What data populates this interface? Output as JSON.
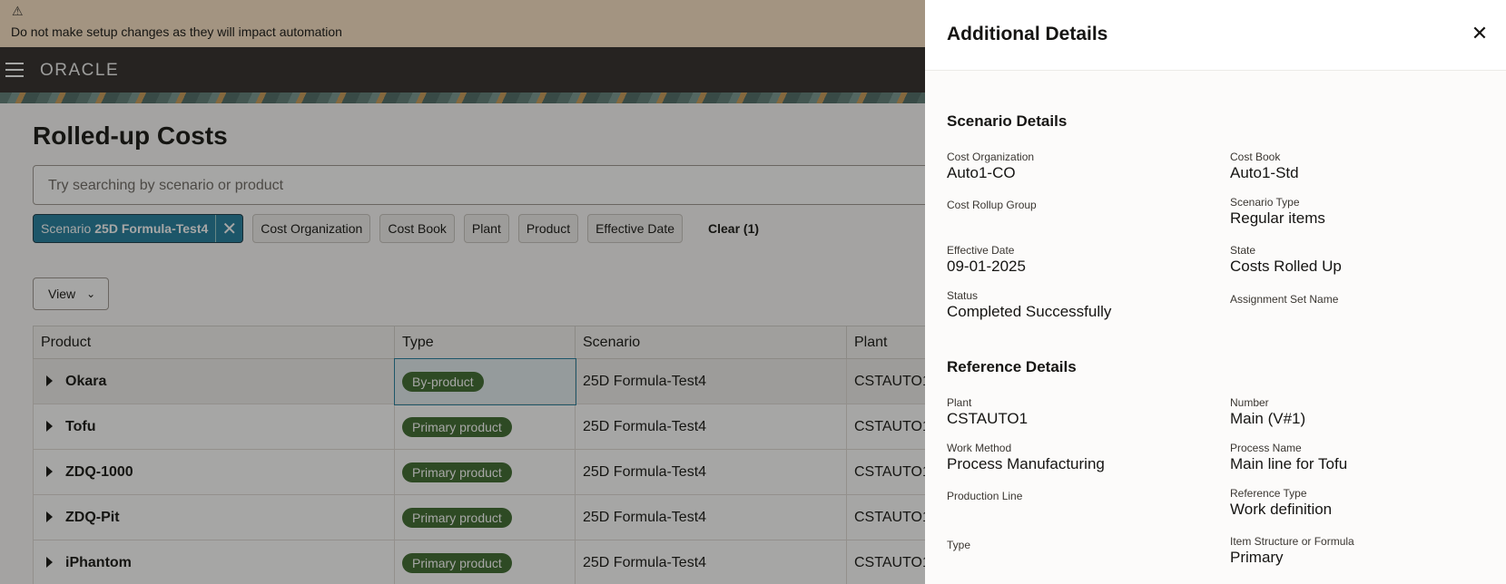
{
  "banner": {
    "warning_icon": "warning-icon",
    "message": "Do not make setup changes as they will impact automation"
  },
  "header": {
    "logo": "ORACLE"
  },
  "page": {
    "title": "Rolled-up Costs",
    "search_placeholder": "Try searching by scenario or product",
    "active_filter": {
      "label": "Scenario",
      "value": "25D Formula-Test4"
    },
    "filters": [
      "Cost Organization",
      "Cost Book",
      "Plant",
      "Product",
      "Effective Date"
    ],
    "clear_label": "Clear (1)",
    "view_label": "View"
  },
  "table": {
    "columns": [
      "Product",
      "Type",
      "Scenario",
      "Plant"
    ],
    "rows": [
      {
        "product": "Okara",
        "type": "By-product",
        "scenario": "25D Formula-Test4",
        "plant": "CSTAUTO1"
      },
      {
        "product": "Tofu",
        "type": "Primary product",
        "scenario": "25D Formula-Test4",
        "plant": "CSTAUTO1"
      },
      {
        "product": "ZDQ-1000",
        "type": "Primary product",
        "scenario": "25D Formula-Test4",
        "plant": "CSTAUTO1"
      },
      {
        "product": "ZDQ-Pit",
        "type": "Primary product",
        "scenario": "25D Formula-Test4",
        "plant": "CSTAUTO1"
      },
      {
        "product": "iPhantom",
        "type": "Primary product",
        "scenario": "25D Formula-Test4",
        "plant": "CSTAUTO1"
      }
    ]
  },
  "panel": {
    "title": "Additional Details",
    "scenario_section": "Scenario Details",
    "cost_org_label": "Cost Organization",
    "cost_org_value": "Auto1-CO",
    "cost_book_label": "Cost Book",
    "cost_book_value": "Auto1-Std",
    "rollup_group_label": "Cost Rollup Group",
    "scenario_type_label": "Scenario Type",
    "scenario_type_value": "Regular items",
    "effective_date_label": "Effective Date",
    "effective_date_value": "09-01-2025",
    "state_label": "State",
    "state_value": "Costs Rolled Up",
    "status_label": "Status",
    "status_value": "Completed Successfully",
    "assignment_set_label": "Assignment Set Name",
    "reference_section": "Reference Details",
    "plant_label": "Plant",
    "plant_value": "CSTAUTO1",
    "number_label": "Number",
    "number_value": "Main (V#1)",
    "work_method_label": "Work Method",
    "work_method_value": "Process Manufacturing",
    "process_name_label": "Process Name",
    "process_name_value": "Main line for Tofu",
    "production_line_label": "Production Line",
    "reference_type_label": "Reference Type",
    "reference_type_value": "Work definition",
    "type_label": "Type",
    "item_structure_label": "Item Structure or Formula",
    "item_structure_value": "Primary"
  },
  "colors": {
    "accent": "#227e9e",
    "badge": "#3e6b2f",
    "header_bg": "#312d2a",
    "banner_bg": "#fbe3c6"
  }
}
